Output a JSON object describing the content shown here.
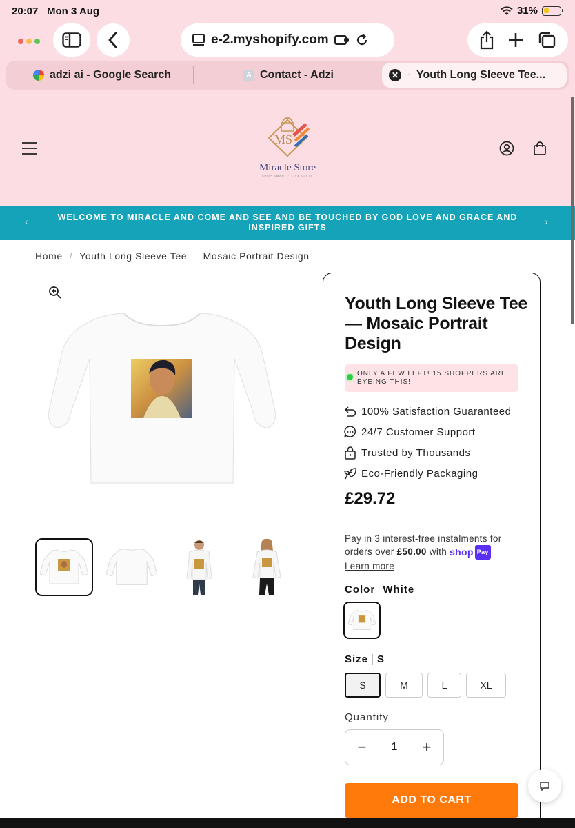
{
  "status_bar": {
    "time": "20:07",
    "date": "Mon 3 Aug",
    "battery": "31%",
    "battery_level": 0.31
  },
  "browser": {
    "address": "e-2.myshopify.com",
    "tabs": [
      {
        "label": "adzi ai - Google Search"
      },
      {
        "label": "Contact - Adzi"
      },
      {
        "label": "Youth Long Sleeve Tee..."
      }
    ]
  },
  "store": {
    "logo_letters": "MS",
    "logo_name": "Miracle Store",
    "logo_tagline": "SHOP SMART · LIVE GIFTS",
    "announcement": "WELCOME TO MIRACLE AND COME AND SEE AND BE TOUCHED BY GOD LOVE AND GRACE AND INSPIRED GIFTS"
  },
  "breadcrumb": {
    "home": "Home",
    "sep": "/",
    "current": "Youth Long Sleeve Tee — Mosaic Portrait Design"
  },
  "product": {
    "title": "Youth Long Sleeve Tee — Mosaic Portrait Design",
    "stock_message": "ONLY A FEW LEFT! 15 SHOPPERS ARE EYEING THIS!",
    "features": [
      {
        "icon": "return-arrow-icon",
        "label": "100% Satisfaction Guaranteed"
      },
      {
        "icon": "chat-bubble-icon",
        "label": "24/7 Customer Support"
      },
      {
        "icon": "lock-icon",
        "label": "Trusted by Thousands"
      },
      {
        "icon": "leaf-icon",
        "label": "Eco-Friendly Packaging"
      }
    ],
    "price": "£29.72",
    "installments_text": "Pay in 3 interest-free instalments for orders over",
    "installments_threshold": "£50.00",
    "installments_with": "with",
    "shop_pay_shop": "shop",
    "shop_pay_pay": "Pay",
    "learn_more": "Learn more",
    "color_label": "Color",
    "color_value": "White",
    "size_label": "Size",
    "size_value": "S",
    "sizes": [
      "S",
      "M",
      "L",
      "XL"
    ],
    "quantity_label": "Quantity",
    "quantity": "1",
    "add_to_cart": "ADD TO CART"
  },
  "colors": {
    "pink_bg": "#fbdde3",
    "announcement_bg": "#14a3b8",
    "add_to_cart": "#ff7a0a",
    "shop_pay": "#5a31f4",
    "stock_bg": "#fde3e6"
  }
}
